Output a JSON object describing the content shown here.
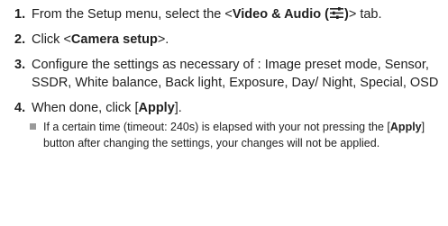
{
  "steps": [
    {
      "num": "1.",
      "pre": "From the Setup menu, select the <",
      "bold": "Video & Audio (",
      "icon": "settings-sliders-icon",
      "bold_close": ")",
      "post": "> tab."
    },
    {
      "num": "2.",
      "pre": "Click <",
      "bold": "Camera setup",
      "post": ">."
    },
    {
      "num": "3.",
      "text": "Configure the settings as necessary of : Image preset mode, Sensor, SSDR, White balance, Back light, Exposure, Day/ Night, Special, OSD"
    },
    {
      "num": "4.",
      "pre": "When done, click [",
      "bold": "Apply",
      "post": "]."
    }
  ],
  "note": {
    "pre": "If a certain time (timeout: 240s) is elapsed with your not pressing the [",
    "bold": "Apply",
    "post": "] button after changing the settings, your changes will not be applied."
  }
}
